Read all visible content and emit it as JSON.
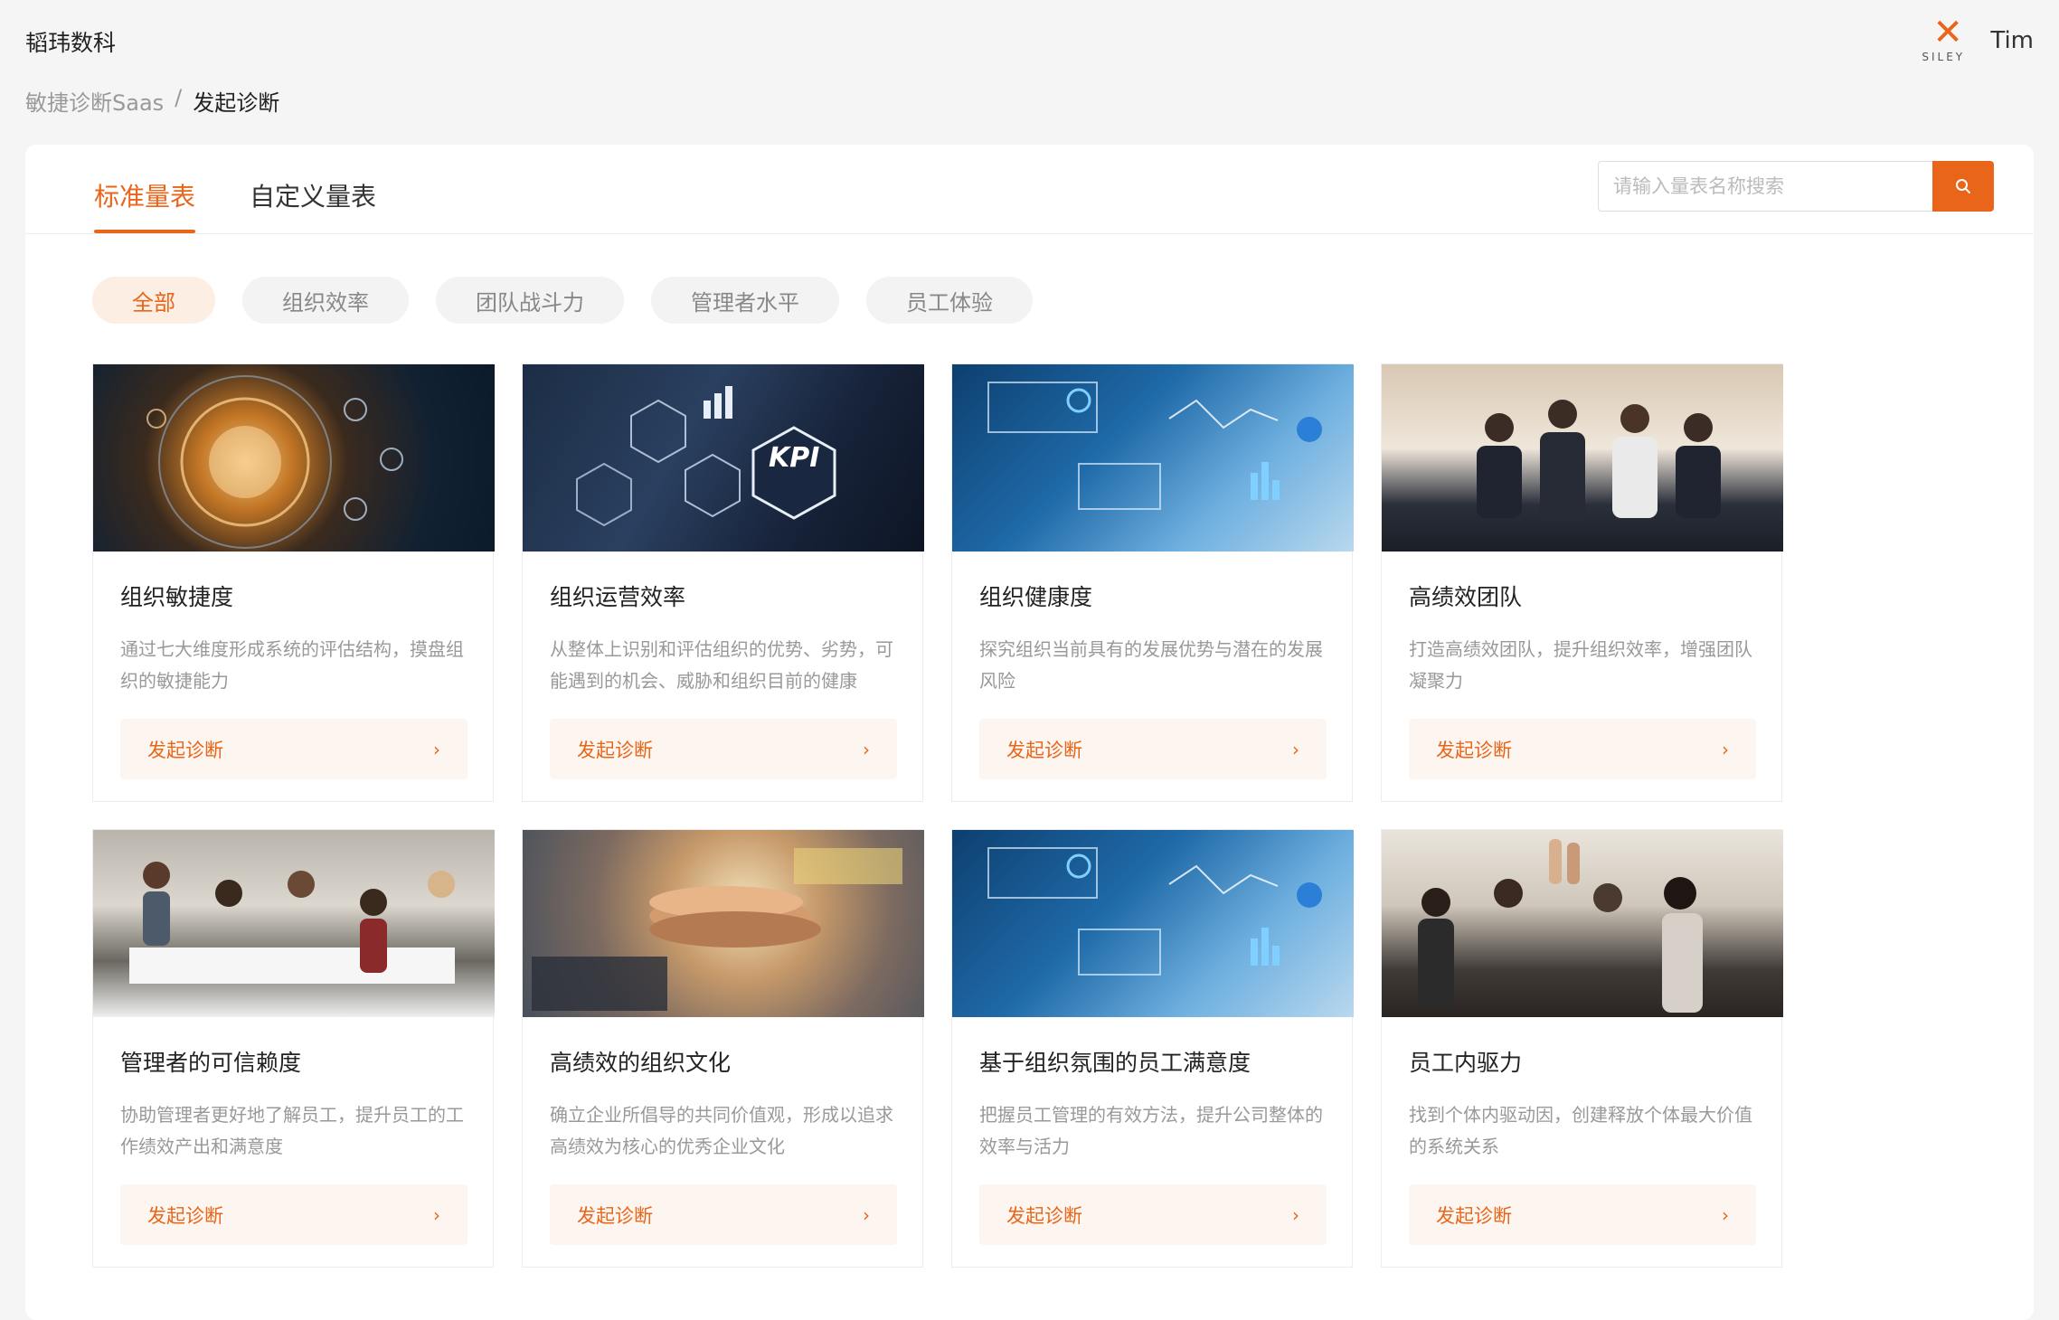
{
  "header": {
    "brand": "韬玮数科",
    "logo_text": "SILEY",
    "user_name": "Tim"
  },
  "breadcrumb": {
    "parent": "敏捷诊断Saas",
    "separator": "/",
    "current": "发起诊断"
  },
  "tabs": [
    {
      "label": "标准量表",
      "active": true
    },
    {
      "label": "自定义量表",
      "active": false
    }
  ],
  "search": {
    "placeholder": "请输入量表名称搜索",
    "value": ""
  },
  "filters": [
    {
      "label": "全部",
      "active": true
    },
    {
      "label": "组织效率",
      "active": false
    },
    {
      "label": "团队战斗力",
      "active": false
    },
    {
      "label": "管理者水平",
      "active": false
    },
    {
      "label": "员工体验",
      "active": false
    }
  ],
  "cards": [
    {
      "title": "组织敏捷度",
      "desc": "通过七大维度形成系统的评估结构，摸盘组织的敏捷能力",
      "button": "发起诊断",
      "image": "tech-globe-image"
    },
    {
      "title": "组织运营效率",
      "desc": "从整体上识别和评估组织的优势、劣势，可能遇到的机会、威胁和组织目前的健康",
      "button": "发起诊断",
      "image": "kpi-image",
      "image_text": "KPI"
    },
    {
      "title": "组织健康度",
      "desc": "探究组织当前具有的发展优势与潜在的发展风险",
      "button": "发起诊断",
      "image": "finance-dashboard-image"
    },
    {
      "title": "高绩效团队",
      "desc": "打造高绩效团队，提升组织效率，增强团队凝聚力",
      "button": "发起诊断",
      "image": "office-team-image"
    },
    {
      "title": "管理者的可信赖度",
      "desc": "协助管理者更好地了解员工，提升员工的工作绩效产出和满意度",
      "button": "发起诊断",
      "image": "celebrating-team-image"
    },
    {
      "title": "高绩效的组织文化",
      "desc": "确立企业所倡导的共同价值观，形成以追求高绩效为核心的优秀企业文化",
      "button": "发起诊断",
      "image": "stacked-hands-image"
    },
    {
      "title": "基于组织氛围的员工满意度",
      "desc": "把握员工管理的有效方法，提升公司整体的效率与活力",
      "button": "发起诊断",
      "image": "finance-dashboard-image"
    },
    {
      "title": "员工内驱力",
      "desc": "找到个体内驱动因，创建释放个体最大价值的系统关系",
      "button": "发起诊断",
      "image": "high-five-image"
    }
  ],
  "colors": {
    "accent": "#e8651a",
    "accent_light": "#fdeee4",
    "button_bg": "#fdf6f0"
  }
}
